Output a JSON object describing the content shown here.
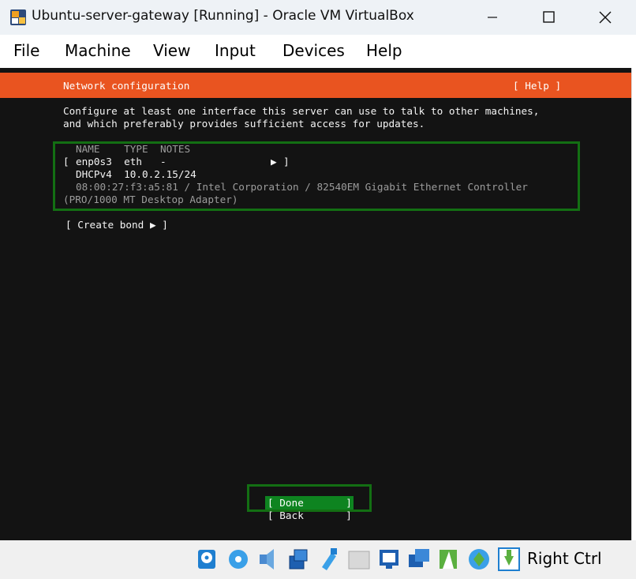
{
  "window": {
    "title": "Ubuntu-server-gateway [Running] - Oracle VM VirtualBox"
  },
  "menu": [
    "File",
    "Machine",
    "View",
    "Input",
    "Devices",
    "Help"
  ],
  "installer": {
    "header_title": "Network configuration",
    "help_button": "[ Help ]",
    "intro_line1": "Configure at least one interface this server can use to talk to other machines,",
    "intro_line2": "and which preferably provides sufficient access for updates.",
    "table_header": "NAME    TYPE  NOTES",
    "iface_row_open": "[",
    "iface_row": "enp0s3  eth   -",
    "iface_row_arrow": "▶",
    "iface_row_close": "]",
    "dhcp_row": "DHCPv4  10.0.2.15/24",
    "hw_line1": "08:00:27:f3:a5:81 / Intel Corporation / 82540EM Gigabit Ethernet Controller",
    "hw_line2": "(PRO/1000 MT Desktop Adapter)",
    "create_bond": "[ Create bond ▶ ]",
    "done_button": "[ Done       ]",
    "back_button": "[ Back       ]",
    "accent_color": "#e95420",
    "highlight_color": "#0e8420"
  },
  "statusbar": {
    "icons": [
      "hard-disk-icon",
      "optical-drive-icon",
      "audio-icon",
      "network-icon",
      "usb-icon",
      "shared-folders-icon",
      "display-icon",
      "capture-icon",
      "recording-icon",
      "cpu-icon",
      "mouse-integration-icon",
      "host-key-icon"
    ],
    "host_key": "Right Ctrl"
  }
}
